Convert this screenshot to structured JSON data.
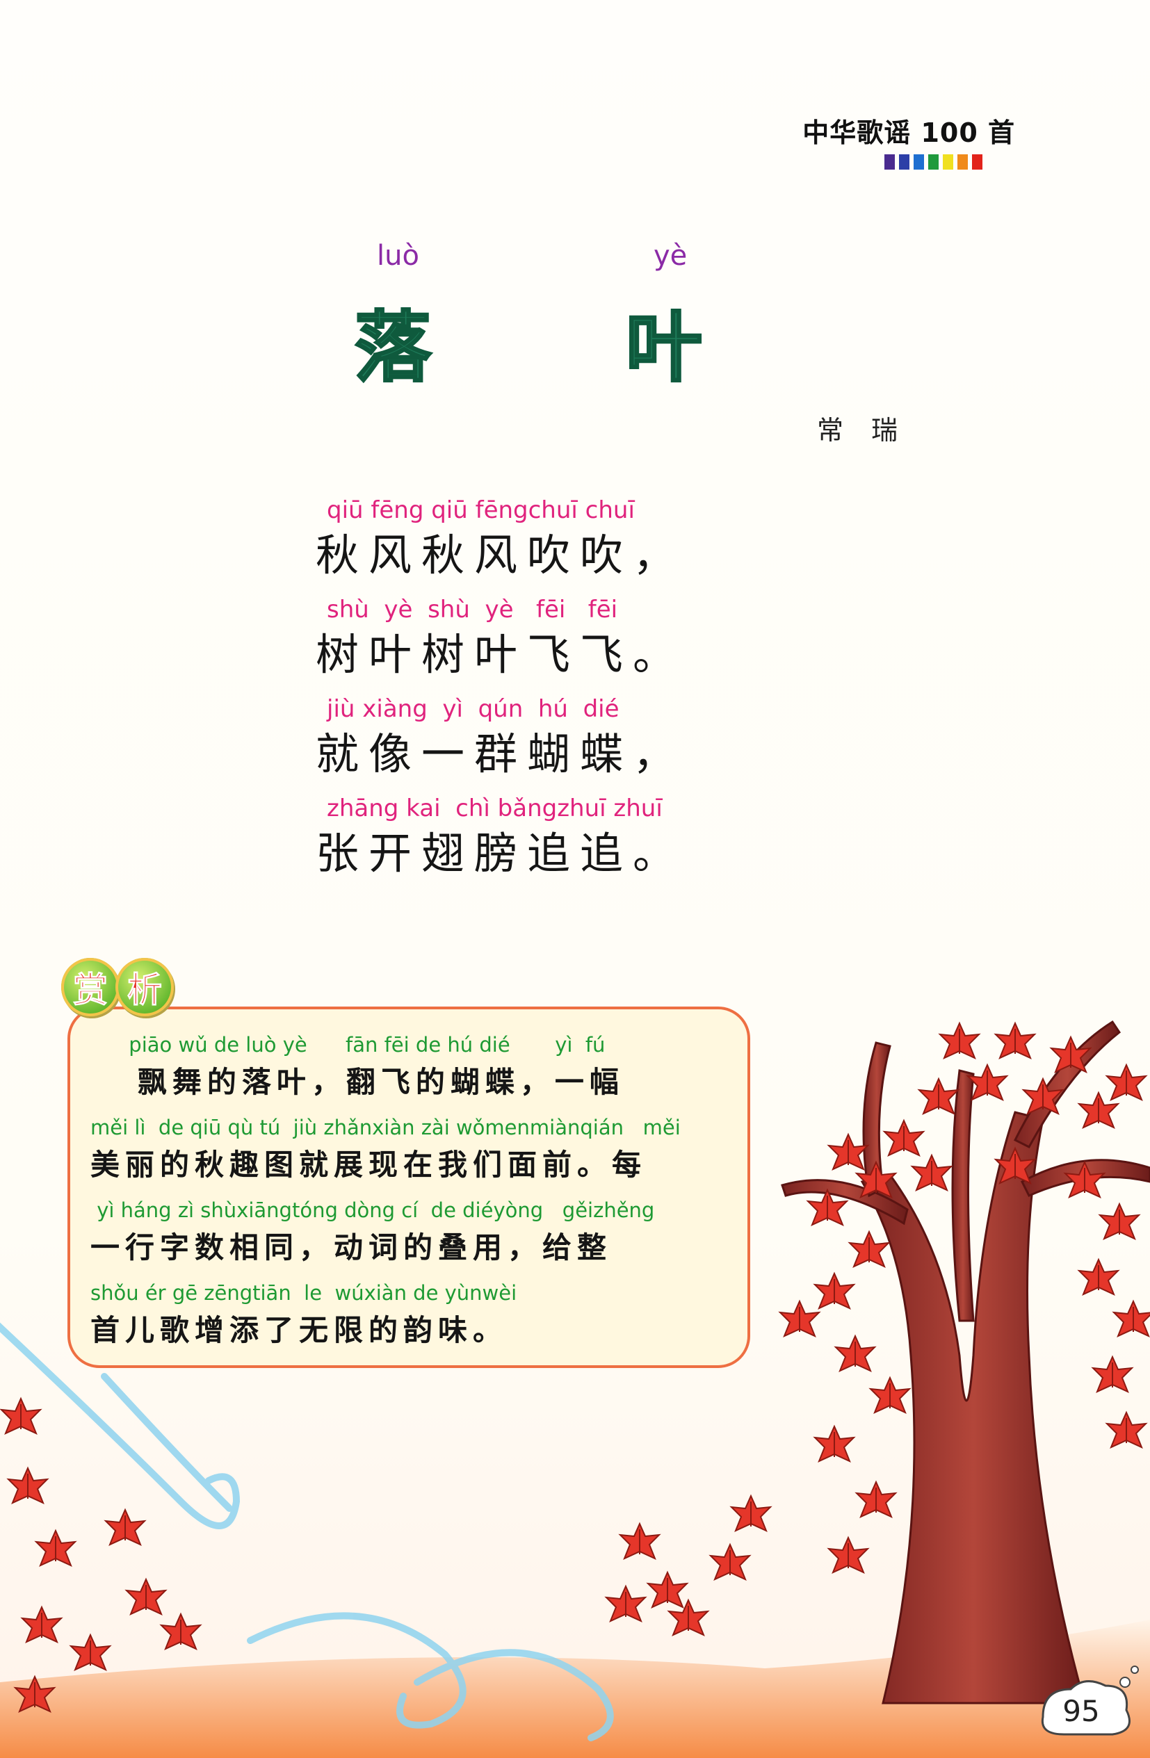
{
  "header": {
    "series_title": "中华歌谣 100 首",
    "strip_colors": [
      "#4a2b8f",
      "#2d3fa7",
      "#1e6fd0",
      "#1f9a3c",
      "#f0e020",
      "#f08a1a",
      "#e2231a"
    ]
  },
  "title": {
    "pinyin": [
      "luò",
      "yè"
    ],
    "characters": [
      "落",
      "叶"
    ],
    "author": "常瑞"
  },
  "poem": [
    {
      "pinyin": "qiū fēng qiū fēngchuī chuī",
      "text": "秋风秋风吹吹，"
    },
    {
      "pinyin": "shù  yè  shù  yè   fēi   fēi",
      "text": "树叶树叶飞飞。"
    },
    {
      "pinyin": "jiù xiàng  yì  qún  hú  dié",
      "text": "就像一群蝴蝶，"
    },
    {
      "pinyin": "zhāng kai  chì bǎngzhuī zhuī",
      "text": "张开翅膀追追。"
    }
  ],
  "analysis": {
    "badge": [
      "赏",
      "析"
    ],
    "lines": [
      {
        "pinyin": "      piāo wǔ de luò yè      fān fēi de hú dié       yì  fú",
        "text": "   飘舞的落叶，翻飞的蝴蝶，一幅"
      },
      {
        "pinyin": "měi lì  de qiū qù tú  jiù zhǎnxiàn zài wǒmenmiànqián   měi",
        "text": "美丽的秋趣图就展现在我们面前。每"
      },
      {
        "pinyin": " yì háng zì shùxiāngtóng dòng cí  de diéyòng   gěizhěng",
        "text": "一行字数相同，动词的叠用，给整"
      },
      {
        "pinyin": "shǒu ér gē zēngtiān  le  wúxiàn de yùnwèi",
        "text": "首儿歌增添了无限的韵味。"
      }
    ]
  },
  "page_number": "95"
}
